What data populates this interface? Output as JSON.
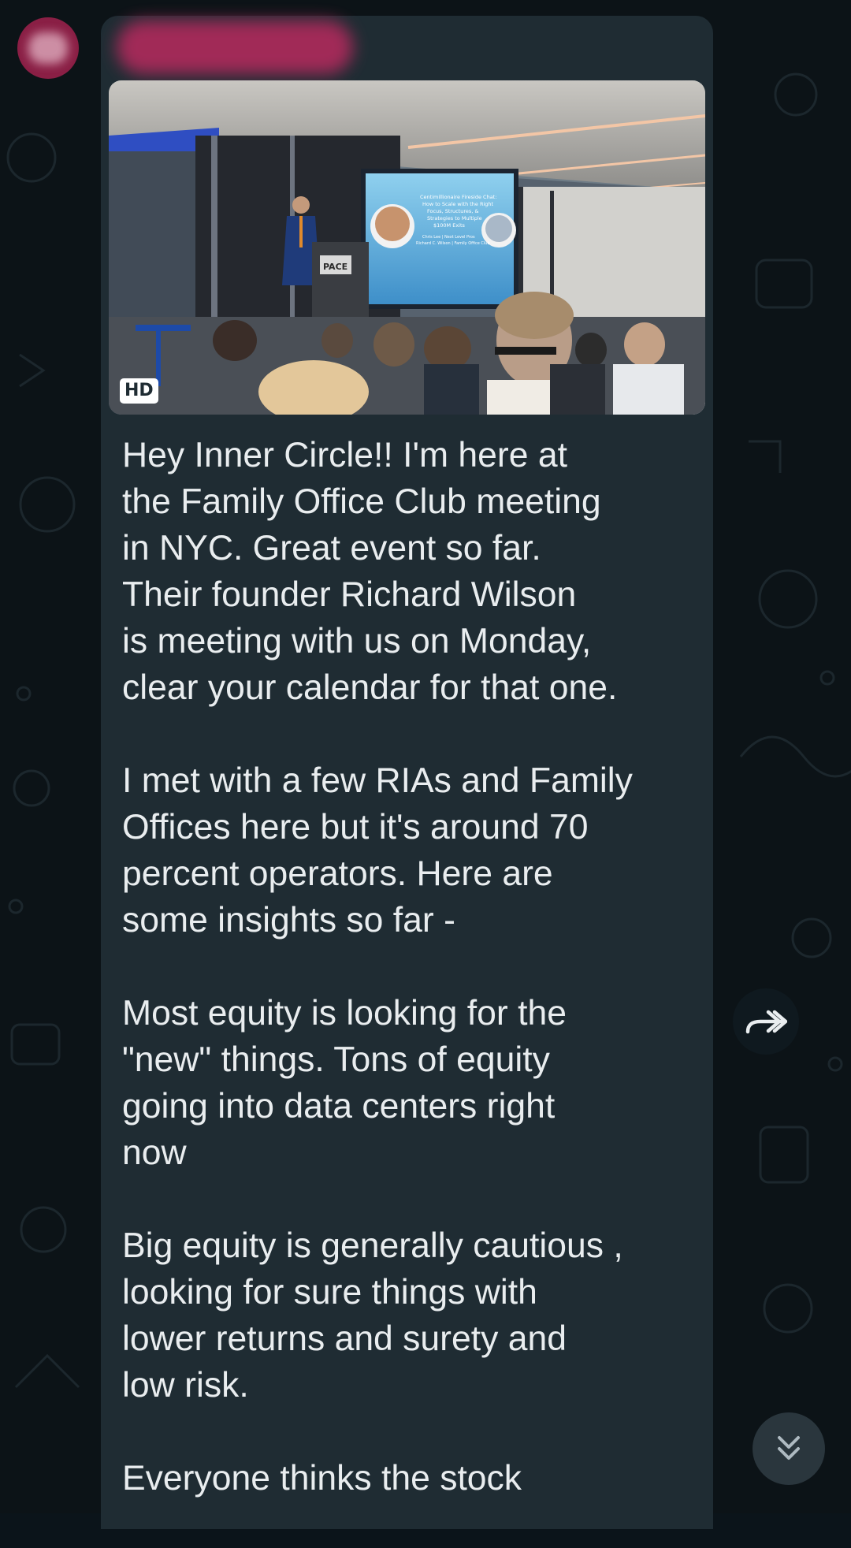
{
  "chat": {
    "photo": {
      "badge": "HD",
      "podium_sign": "PACE",
      "slide_lines": [
        "Centimillionaire Fireside Chat:",
        "How to Scale with the Right",
        "Focus, Structures, &",
        "Strategies to Multiple",
        "$100M Exits",
        "Chris Lee | Next Level Pros",
        "Richard C. Wilson | Family Office Club"
      ]
    },
    "message": {
      "paragraphs": [
        "Hey Inner Circle!!  I'm here at\nthe Family Office Club meeting\nin NYC.  Great event so far.\nTheir founder Richard Wilson\nis meeting with us on Monday,\nclear your calendar for that one.",
        "I met with a few RIAs and Family\nOffices here but it's around 70\npercent operators.  Here are\nsome insights so far -",
        "Most equity is looking for the\n\"new\" things.  Tons of equity\ngoing into data centers right\nnow",
        "Big equity is generally cautious ,\nlooking for sure things with\nlower returns and surety and\nlow risk.",
        "Everyone thinks the stock"
      ]
    },
    "icons": {
      "forward": "forward-icon",
      "scroll_down": "double-chevron-down-icon"
    },
    "colors": {
      "bubble": "#1f2c33",
      "text": "#e9edef",
      "background": "#0c1317",
      "avatar": "#8a1f45"
    }
  }
}
